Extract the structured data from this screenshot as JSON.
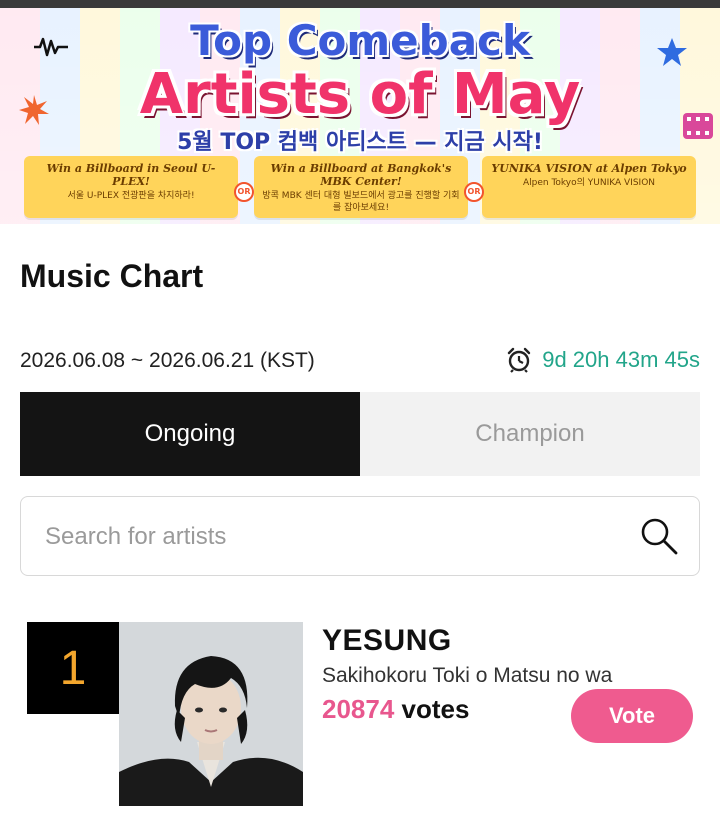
{
  "banner": {
    "title_line1": "Top Comeback",
    "title_line2": "Artists of May",
    "subtitle": "5월 TOP 컴백 아티스트 — 지금 시작!",
    "promos": [
      {
        "title": "Win a Billboard in Seoul U-PLEX!",
        "korean": "서울 U-PLEX 전광판을 차지하라!"
      },
      {
        "title": "Win a Billboard at Bangkok's MBK Center!",
        "korean": "방콕 MBK 센터 대형 빌보드에서 광고를 진행할 기회를 잡아보세요!"
      },
      {
        "title": "YUNIKA VISION at Alpen Tokyo",
        "korean": "Alpen Tokyo의 YUNIKA VISION"
      }
    ],
    "or_label": "OR"
  },
  "page": {
    "title": "Music Chart",
    "date_range": "2026.06.08 ~ 2026.06.21 (KST)",
    "countdown": "9d 20h 43m 45s",
    "colors": {
      "accent": "#ef5b8f",
      "timer": "#22a58a",
      "rank": "#f3a62d"
    }
  },
  "tabs": {
    "ongoing": "Ongoing",
    "champion": "Champion",
    "active": "Ongoing"
  },
  "search": {
    "placeholder": "Search for artists",
    "value": ""
  },
  "chart": {
    "entries": [
      {
        "rank": "1",
        "artist": "YESUNG",
        "song": "Sakihokoru Toki o Matsu no wa",
        "votes": "20874",
        "votes_suffix": " votes",
        "vote_button": "Vote"
      }
    ]
  }
}
